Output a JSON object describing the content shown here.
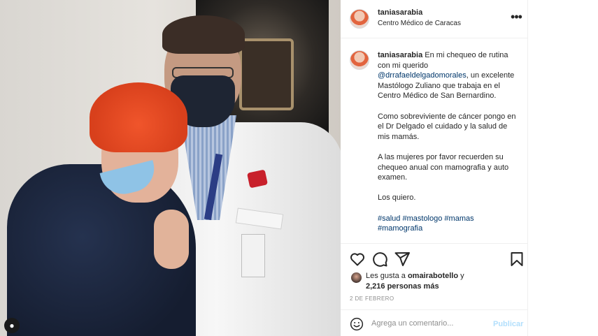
{
  "post": {
    "username": "taniasarabia",
    "location": "Centro Médico de Caracas"
  },
  "caption": {
    "username": "taniasarabia",
    "line1": "En mi chequeo de rutina con mi querido",
    "mention": "@drrafaeldelgadomorales",
    "line1_after": ", un excelente Mastólogo Zuliano que trabaja en el Centro Médico de San Bernardino.",
    "para2": "Como sobreviviente de cáncer pongo en el Dr Delgado el cuidado y la salud de mis mamás.",
    "para3": "A las mujeres por favor recuerden su chequeo anual con mamografia y auto examen.",
    "para4": "Los quiero.",
    "hashtags": [
      "#salud",
      "#mastologo",
      "#mamas",
      "#mamografia"
    ]
  },
  "likes": {
    "prefix": "Les gusta a",
    "liker": "omairabotello",
    "joiner": "y",
    "count_text": "2,216 personas más"
  },
  "timestamp": "2 de febrero",
  "comment": {
    "placeholder": "Agrega un comentario...",
    "post_label": "Publicar"
  },
  "icons": {
    "more": "more-options-icon",
    "like": "heart-icon",
    "comment": "comment-icon",
    "share": "send-icon",
    "save": "bookmark-icon",
    "emoji": "emoji-icon",
    "tagged_user": "user-icon"
  },
  "colors": {
    "text": "#262626",
    "link": "#00376b",
    "secondary": "#8e8e8e",
    "border": "#efefef",
    "post_button_disabled": "#b2dffc"
  }
}
